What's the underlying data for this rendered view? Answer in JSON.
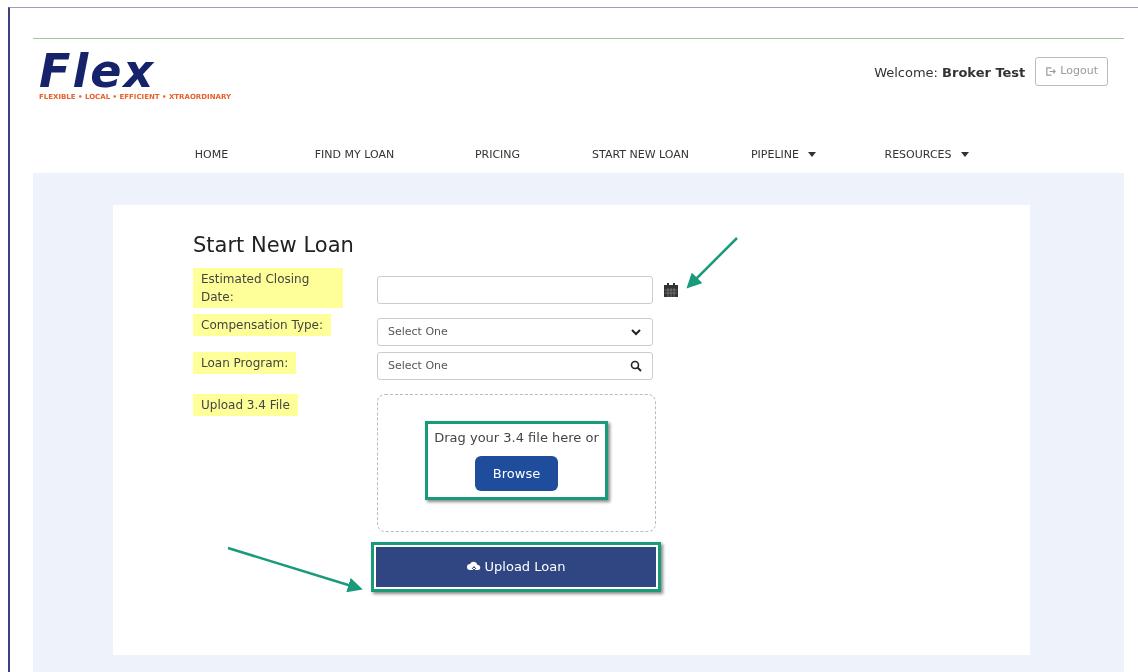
{
  "logo": {
    "wordmark": "Flex",
    "tagline": "FLEXIBLE • LOCAL • EFFICIENT • XTRAORDINARY"
  },
  "user": {
    "greeting": "Welcome:",
    "name": "Broker Test",
    "logout": "Logout"
  },
  "nav": [
    {
      "label": "HOME",
      "dropdown": false
    },
    {
      "label": "FIND MY LOAN",
      "dropdown": false
    },
    {
      "label": "PRICING",
      "dropdown": false
    },
    {
      "label": "START NEW LOAN",
      "dropdown": false
    },
    {
      "label": "PIPELINE",
      "dropdown": true
    },
    {
      "label": "RESOURCES",
      "dropdown": true
    }
  ],
  "form": {
    "title": "Start New Loan",
    "fields": [
      {
        "kind": "date",
        "label": "Estimated Closing Date:",
        "highlighted": true
      },
      {
        "kind": "select",
        "label": "Compensation Type:",
        "value": "Select One",
        "highlighted": true
      },
      {
        "kind": "search",
        "label": "Loan Program:",
        "value": "Select One",
        "highlighted": true
      },
      {
        "kind": "upload",
        "label": "Upload 3.4 File",
        "highlighted": true,
        "prompt": "Drag your 3.4 file here or",
        "button": "Browse",
        "callout": true
      }
    ],
    "submit": {
      "label": "Upload Loan",
      "callout": true
    }
  }
}
